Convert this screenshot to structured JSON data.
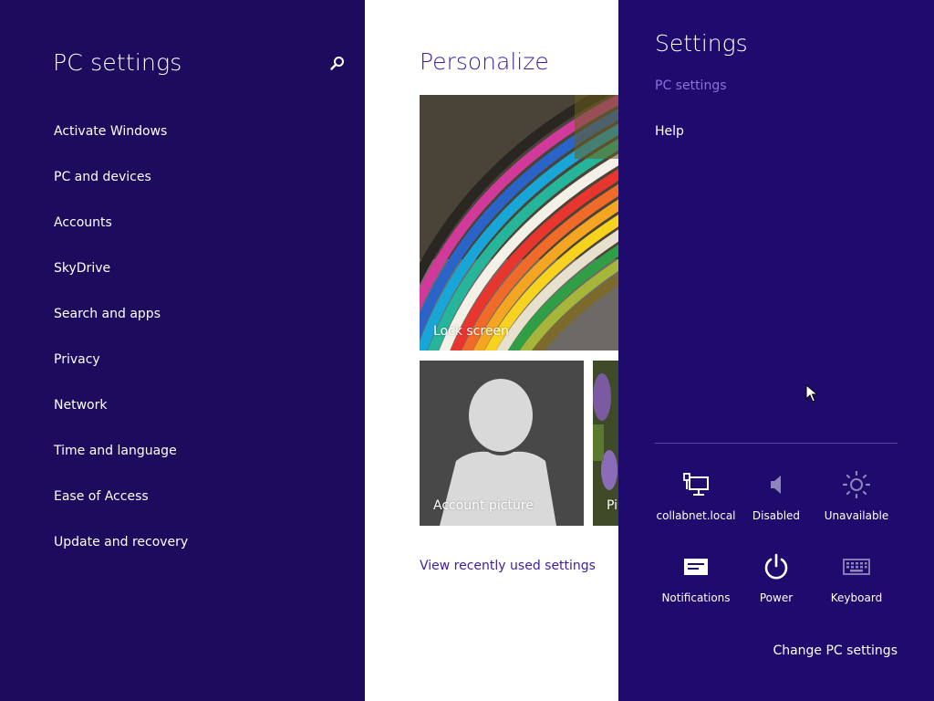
{
  "colors": {
    "left_bg": "#1d0b5e",
    "charm_bg": "#1f0a6e",
    "accent": "#3e1e9c",
    "charm_subtitle": "#8c73dc",
    "white": "#ffffff"
  },
  "left_pane": {
    "title": "PC settings",
    "search_icon": "magnifier-icon",
    "nav_items": [
      "Activate Windows",
      "PC and devices",
      "Accounts",
      "SkyDrive",
      "Search and apps",
      "Privacy",
      "Network",
      "Time and language",
      "Ease of Access",
      "Update and recovery"
    ]
  },
  "center_pane": {
    "title": "Personalize",
    "tiles": {
      "lock_screen": "Lock screen",
      "account_picture": "Account picture",
      "picture_password": "Pi"
    },
    "recent_link": "View recently used settings"
  },
  "charm": {
    "title": "Settings",
    "subtitle": "PC settings",
    "help": "Help",
    "quick_tiles": [
      {
        "label": "collabnet.local",
        "icon": "network-icon"
      },
      {
        "label": "Disabled",
        "icon": "speaker-icon"
      },
      {
        "label": "Unavailable",
        "icon": "brightness-icon"
      },
      {
        "label": "Notifications",
        "icon": "notifications-icon"
      },
      {
        "label": "Power",
        "icon": "power-icon"
      },
      {
        "label": "Keyboard",
        "icon": "keyboard-icon"
      }
    ],
    "change_pc_settings": "Change PC settings"
  }
}
